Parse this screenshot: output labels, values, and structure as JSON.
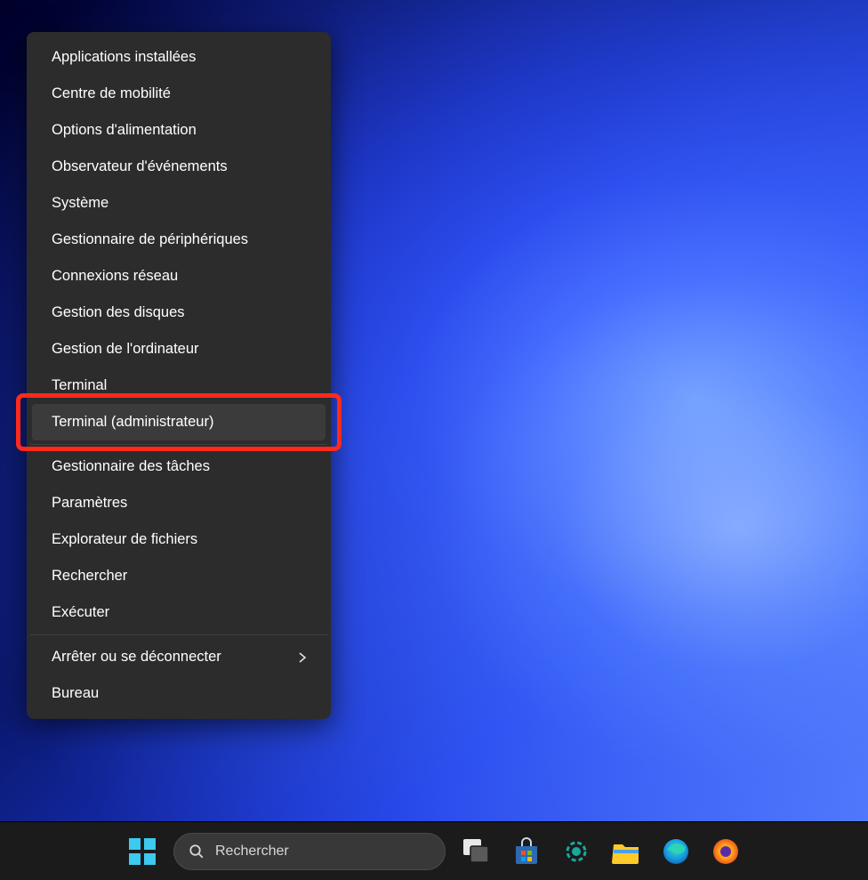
{
  "menu": {
    "groups": [
      {
        "items": [
          {
            "id": "menu-installed-apps",
            "label": "Applications installées",
            "hovered": false,
            "submenu": false
          },
          {
            "id": "menu-mobility-center",
            "label": "Centre de mobilité",
            "hovered": false,
            "submenu": false
          },
          {
            "id": "menu-power-options",
            "label": "Options d'alimentation",
            "hovered": false,
            "submenu": false
          },
          {
            "id": "menu-event-viewer",
            "label": "Observateur d'événements",
            "hovered": false,
            "submenu": false
          },
          {
            "id": "menu-system",
            "label": "Système",
            "hovered": false,
            "submenu": false
          },
          {
            "id": "menu-device-manager",
            "label": "Gestionnaire de périphériques",
            "hovered": false,
            "submenu": false
          },
          {
            "id": "menu-network-connections",
            "label": "Connexions réseau",
            "hovered": false,
            "submenu": false
          },
          {
            "id": "menu-disk-management",
            "label": "Gestion des disques",
            "hovered": false,
            "submenu": false
          },
          {
            "id": "menu-computer-management",
            "label": "Gestion de l'ordinateur",
            "hovered": false,
            "submenu": false
          },
          {
            "id": "menu-terminal",
            "label": "Terminal",
            "hovered": false,
            "submenu": false
          },
          {
            "id": "menu-terminal-admin",
            "label": "Terminal (administrateur)",
            "hovered": true,
            "submenu": false,
            "highlighted": true
          }
        ]
      },
      {
        "items": [
          {
            "id": "menu-task-manager",
            "label": "Gestionnaire des tâches",
            "hovered": false,
            "submenu": false
          },
          {
            "id": "menu-settings",
            "label": "Paramètres",
            "hovered": false,
            "submenu": false
          },
          {
            "id": "menu-file-explorer",
            "label": "Explorateur de fichiers",
            "hovered": false,
            "submenu": false
          },
          {
            "id": "menu-search",
            "label": "Rechercher",
            "hovered": false,
            "submenu": false
          },
          {
            "id": "menu-run",
            "label": "Exécuter",
            "hovered": false,
            "submenu": false
          }
        ]
      },
      {
        "items": [
          {
            "id": "menu-shutdown",
            "label": "Arrêter ou se déconnecter",
            "hovered": false,
            "submenu": true
          },
          {
            "id": "menu-desktop",
            "label": "Bureau",
            "hovered": false,
            "submenu": false
          }
        ]
      }
    ]
  },
  "taskbar": {
    "search_placeholder": "Rechercher",
    "icons": [
      {
        "id": "tb-start",
        "name": "start-icon"
      },
      {
        "id": "tb-search",
        "name": "search-box"
      },
      {
        "id": "tb-taskview",
        "name": "task-view-icon"
      },
      {
        "id": "tb-store",
        "name": "microsoft-store-icon"
      },
      {
        "id": "tb-app-teal",
        "name": "teal-app-icon"
      },
      {
        "id": "tb-explorer",
        "name": "file-explorer-icon"
      },
      {
        "id": "tb-edge",
        "name": "edge-icon"
      },
      {
        "id": "tb-firefox",
        "name": "firefox-icon"
      }
    ]
  },
  "colors": {
    "menu_bg": "#2c2c2c",
    "menu_hover": "#3b3b3b",
    "highlight_border": "#ff2a1a",
    "taskbar_bg": "#1b1b1c"
  }
}
